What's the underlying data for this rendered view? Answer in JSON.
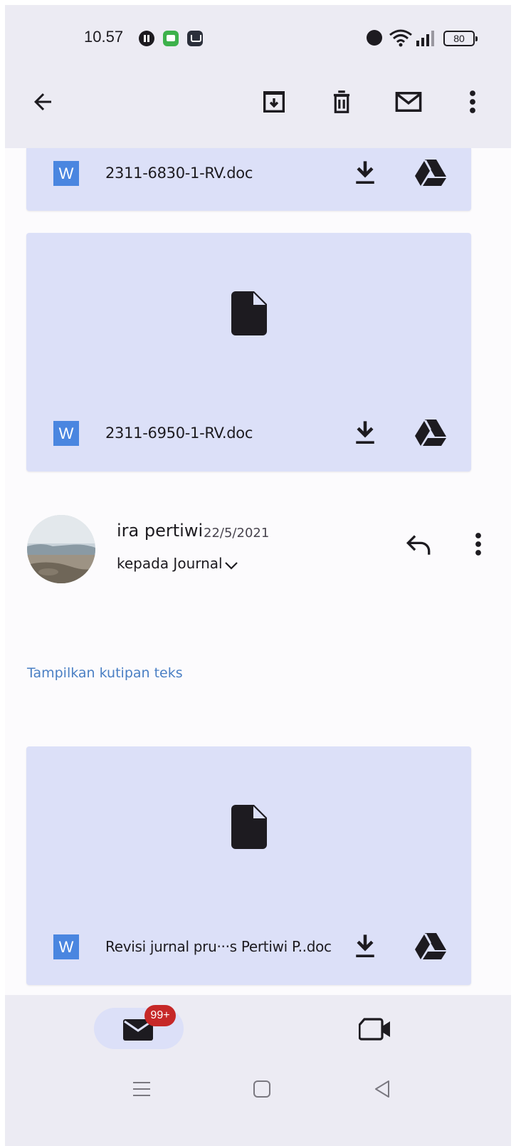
{
  "status_bar": {
    "time": "10.57",
    "battery": "80"
  },
  "appbar": {
    "back_label": "back",
    "actions": [
      "archive",
      "delete",
      "mark-unread",
      "more"
    ]
  },
  "attachments": [
    {
      "file_name": "2311-6830-1-RV.doc",
      "type_badge": "W"
    },
    {
      "file_name": "2311-6950-1-RV.doc",
      "type_badge": "W"
    },
    {
      "file_name": "Revisi jurnal pru···s Pertiwi P..doc",
      "type_badge": "W"
    }
  ],
  "message": {
    "sender": "ira pertiwi",
    "date": "22/5/2021",
    "recipient": "kepada Journal",
    "show_quoted": "Tampilkan kutipan teks"
  },
  "bottom_nav": {
    "mail_badge": "99+"
  },
  "colors": {
    "card": "#dce0f8",
    "bar": "#ecebf3",
    "word": "#4a86e0",
    "link": "#4a7fc4",
    "badge": "#c62828"
  }
}
